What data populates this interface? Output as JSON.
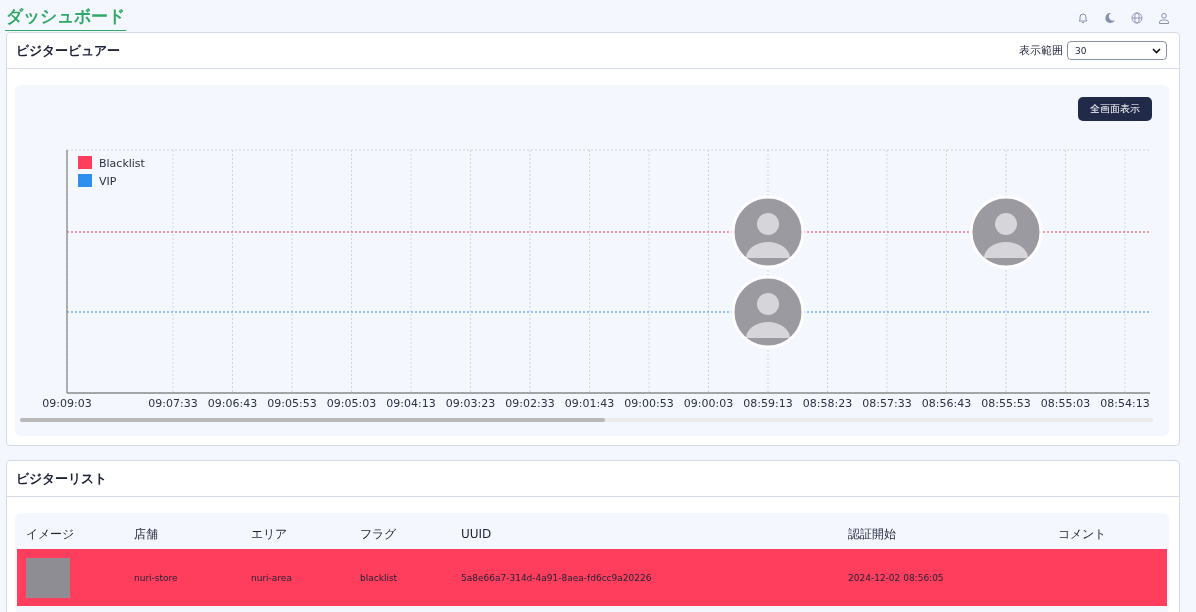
{
  "header": {
    "title": "ダッシュボード"
  },
  "viewer": {
    "title": "ビジタービュアー",
    "range_label": "表示範囲",
    "range_value": "30",
    "fullscreen_button": "全画面表示",
    "legend": [
      {
        "name": "Blacklist",
        "color": "#ff3d5c"
      },
      {
        "name": "VIP",
        "color": "#2f8fef"
      }
    ],
    "timeline": [
      {
        "label": "09:09:03",
        "blacklist": false,
        "vip": false
      },
      {
        "label": "09:07:33",
        "blacklist": false,
        "vip": false
      },
      {
        "label": "09:06:43",
        "blacklist": false,
        "vip": false
      },
      {
        "label": "09:05:53",
        "blacklist": false,
        "vip": false
      },
      {
        "label": "09:05:03",
        "blacklist": false,
        "vip": false
      },
      {
        "label": "09:04:13",
        "blacklist": false,
        "vip": false
      },
      {
        "label": "09:03:23",
        "blacklist": false,
        "vip": false
      },
      {
        "label": "09:02:33",
        "blacklist": false,
        "vip": false
      },
      {
        "label": "09:01:43",
        "blacklist": false,
        "vip": false
      },
      {
        "label": "09:00:53",
        "blacklist": false,
        "vip": false
      },
      {
        "label": "09:00:03",
        "blacklist": false,
        "vip": false
      },
      {
        "label": "08:59:13",
        "blacklist": true,
        "vip": true
      },
      {
        "label": "08:58:23",
        "blacklist": false,
        "vip": false
      },
      {
        "label": "08:57:33",
        "blacklist": false,
        "vip": false
      },
      {
        "label": "08:56:43",
        "blacklist": false,
        "vip": false
      },
      {
        "label": "08:55:53",
        "blacklist": true,
        "vip": false
      },
      {
        "label": "08:55:03",
        "blacklist": false,
        "vip": false
      },
      {
        "label": "08:54:13",
        "blacklist": false,
        "vip": false
      }
    ]
  },
  "list": {
    "title": "ビジターリスト",
    "columns": [
      "イメージ",
      "店舗",
      "エリア",
      "フラグ",
      "UUID",
      "認証開始",
      "コメント"
    ],
    "rows": [
      {
        "color": "#ff3d5c",
        "store": "nuri-store",
        "area": "nuri-area",
        "flag": "blacklist",
        "uuid": "5a8e66a7-314d-4a91-8aea-fd6cc9a20226",
        "started": "2024-12-02 08:56:05"
      }
    ]
  }
}
